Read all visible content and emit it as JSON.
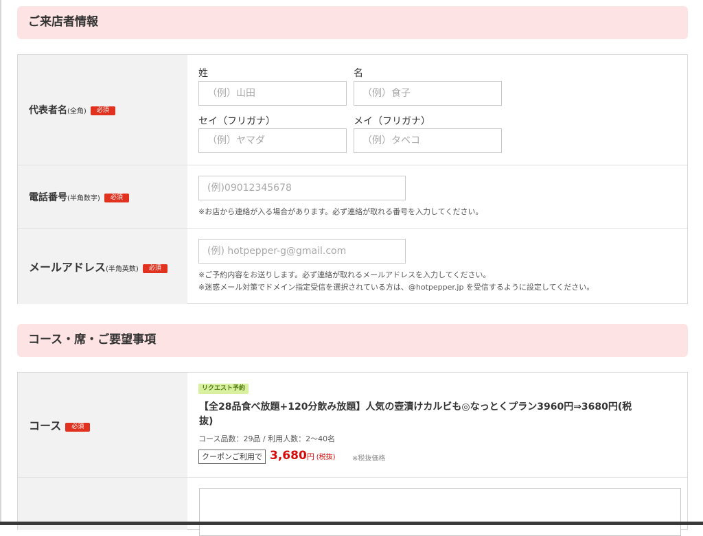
{
  "visitor_section": {
    "title": "ご来店者情報",
    "required_badge": "必須",
    "name_row": {
      "label": "代表者名",
      "note": "(全角)",
      "last_name_label": "姓",
      "first_name_label": "名",
      "last_name_placeholder": "（例）山田",
      "first_name_placeholder": "（例）食子",
      "last_kana_label": "セイ（フリガナ）",
      "first_kana_label": "メイ（フリガナ）",
      "last_kana_placeholder": "（例）ヤマダ",
      "first_kana_placeholder": "（例）タベコ"
    },
    "phone_row": {
      "label": "電話番号",
      "note": "(半角数字)",
      "placeholder": "(例)09012345678",
      "help": "※お店から連絡が入る場合があります。必ず連絡が取れる番号を入力してください。"
    },
    "email_row": {
      "label": "メールアドレス",
      "note": "(半角英数)",
      "placeholder": "(例) hotpepper-g@gmail.com",
      "help_1": "※ご予約内容をお送りします。必ず連絡が取れるメールアドレスを入力してください。",
      "help_2": "※迷惑メール対策でドメイン指定受信を選択されている方は、@hotpepper.jp を受信するように設定してください。"
    }
  },
  "course_section": {
    "title": "コース・席・ご要望事項",
    "course_row": {
      "label": "コース",
      "badge": "リクエスト予約",
      "course_title": "【全28品食べ放題+120分飲み放題】人気の壺漬けカルビも◎なっとくプラン3960円⇒3680円(税抜)",
      "meta": "コース品数：29品 / 利用人数：2～40名",
      "coupon": "クーポンご利用で",
      "price": "3,680",
      "price_unit": "円",
      "price_tax": "(税抜)",
      "price_note": "※税抜価格"
    }
  }
}
